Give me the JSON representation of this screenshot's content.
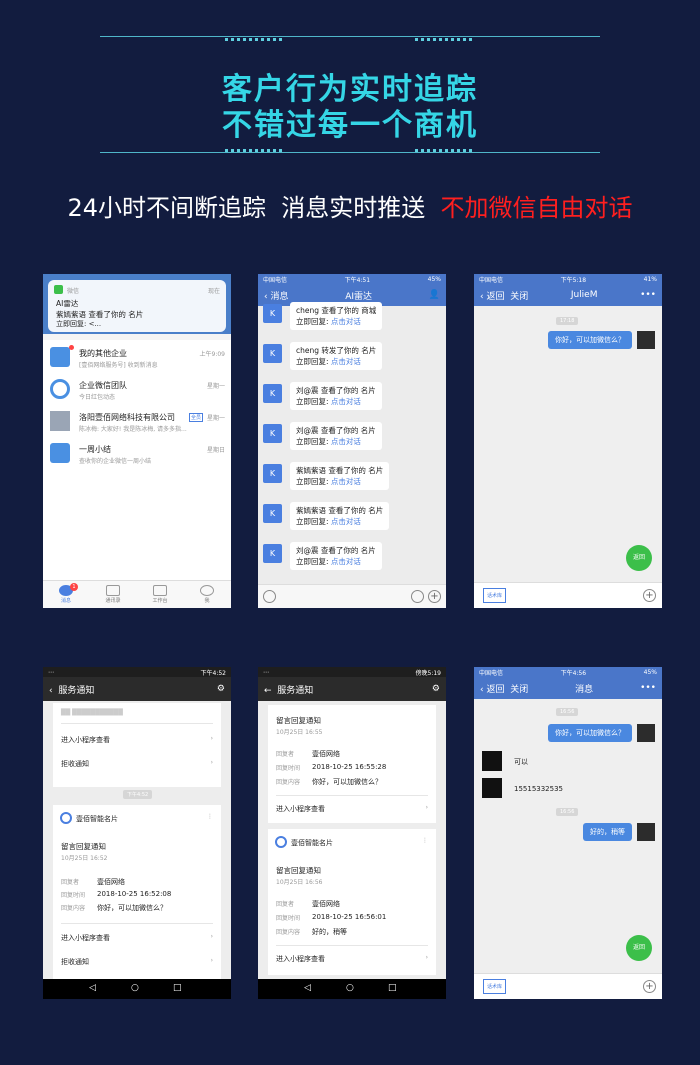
{
  "banner": {
    "line1": "客户行为实时追踪",
    "line2": "不错过每一个商机"
  },
  "slogan": {
    "part1": "24小时不间断追踪",
    "part2": "消息实时推送",
    "part3": "不加微信自由对话"
  },
  "colors": {
    "background": "#121c3f",
    "accent": "#35d6e6",
    "highlight": "#ff1f1f",
    "wx_blue": "#4a76c9",
    "green": "#3cbf4a"
  },
  "phone1": {
    "notif": {
      "app": "微信",
      "time": "现在",
      "title": "AI雷达",
      "line1": "紫嫣紫语 查看了你的 名片",
      "line2": "立即回复: <..."
    },
    "items": [
      {
        "title": "我的其他企业",
        "sub": "[壹佰网络服务号] 收到新消息",
        "time": "上午9:09"
      },
      {
        "title": "企业微信团队",
        "sub": "今日红包动态",
        "time": "星期一"
      },
      {
        "title": "洛阳壹佰网络科技有限公司",
        "badge": "全员",
        "sub": "陈冰梅: 大家好! 我是陈冰梅, 请多多指...",
        "time": "星期一"
      },
      {
        "title": "一周小结",
        "sub": "查收你的企业微信一周小结",
        "time": "星期日"
      }
    ],
    "tabs": [
      "消息",
      "通讯录",
      "工作台",
      "我"
    ],
    "badge": "1"
  },
  "phone2": {
    "status": {
      "carrier": "中国电信",
      "time": "下午4:51",
      "battery": "45%"
    },
    "back": "消息",
    "title": "AI雷达",
    "reply_label": "立即回复:",
    "reply_link": "点击对话",
    "messages": [
      "cheng 查看了你的 商城",
      "cheng 转发了你的 名片",
      "刘@震 查看了你的 名片",
      "刘@震 查看了你的 名片",
      "紫嫣紫语 查看了你的 名片",
      "紫嫣紫语 查看了你的 名片",
      "刘@震 查看了你的 名片"
    ]
  },
  "phone3": {
    "status": {
      "carrier": "中国电信",
      "time": "下午5:18",
      "battery": "41%"
    },
    "back": "返回",
    "close": "关闭",
    "title": "JulieM",
    "more": "•••",
    "stamp": "17:18",
    "msg": "你好，可以加微信么？",
    "green": "返回",
    "library": "话术库"
  },
  "phone4": {
    "time": "下午4:52",
    "title": "服务通知",
    "top_blur": "██ ███████████",
    "link1": "进入小程序查看",
    "link2": "拒收通知",
    "stamp": "下午4:52",
    "card_name": "壹佰智能名片",
    "notice_title": "留言回复通知",
    "notice_date": "10月25日 16:52",
    "fields": [
      {
        "k": "回复者",
        "v": "壹佰网络"
      },
      {
        "k": "回复时间",
        "v": "2018-10-25 16:52:08"
      },
      {
        "k": "回复内容",
        "v": "你好，可以加微信么？"
      }
    ]
  },
  "phone5": {
    "time": "傍晚5:19",
    "title": "服务通知",
    "notice1": {
      "title": "留言回复通知",
      "date": "10月25日 16:55",
      "fields": [
        {
          "k": "回复者",
          "v": "壹佰网络"
        },
        {
          "k": "回复时间",
          "v": "2018-10-25 16:55:28"
        },
        {
          "k": "回复内容",
          "v": "你好，可以加微信么？"
        }
      ]
    },
    "link": "进入小程序查看",
    "card_name": "壹佰智能名片",
    "notice2": {
      "title": "留言回复通知",
      "date": "10月25日 16:56",
      "fields": [
        {
          "k": "回复者",
          "v": "壹佰网络"
        },
        {
          "k": "回复时间",
          "v": "2018-10-25 16:56:01"
        },
        {
          "k": "回复内容",
          "v": "好的，稍等"
        }
      ]
    }
  },
  "phone6": {
    "status": {
      "carrier": "中国电信",
      "time": "下午4:56",
      "battery": "45%"
    },
    "back": "返回",
    "close": "关闭",
    "title": "消息",
    "more": "•••",
    "stamp1": "16:56",
    "msg1": "你好，可以加微信么？",
    "reply1": "可以",
    "reply2": "15515332535",
    "stamp2": "16:56",
    "msg2": "好的，稍等",
    "green": "返回",
    "library": "话术库"
  }
}
